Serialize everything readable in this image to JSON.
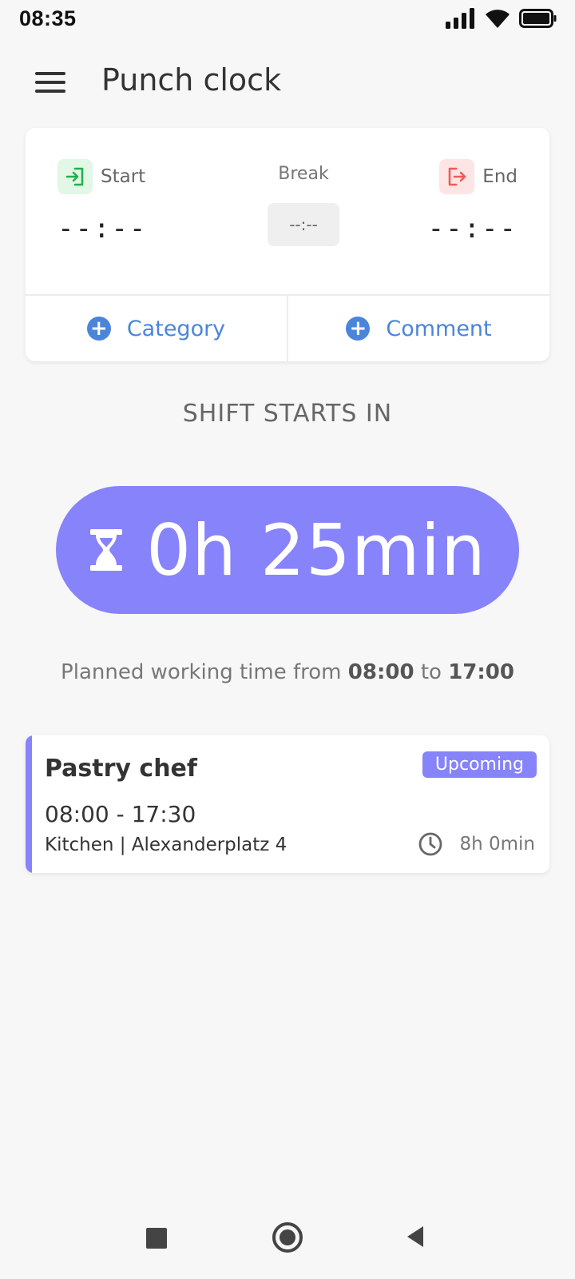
{
  "status_bar": {
    "time": "08:35",
    "icons": [
      "signal-icon",
      "wifi-icon",
      "battery-icon"
    ]
  },
  "app_bar": {
    "title": "Punch clock",
    "menu_icon": "hamburger-menu-icon"
  },
  "punch_card": {
    "start_label": "Start",
    "start_value": "--:--",
    "break_label": "Break",
    "break_value": "--:--",
    "end_label": "End",
    "end_value": "--:--",
    "category_label": "Category",
    "comment_label": "Comment",
    "colors": {
      "start": "#22b14c",
      "end": "#f05a5a",
      "action": "#4a85dc"
    }
  },
  "countdown": {
    "label": "SHIFT STARTS IN",
    "value": "0h 25min",
    "color": "#8683fb"
  },
  "planned": {
    "prefix": "Planned working time from",
    "from": "08:00",
    "connector": "to",
    "to": "17:00"
  },
  "shift": {
    "title": "Pastry chef",
    "badge": "Upcoming",
    "time": "08:00 - 17:30",
    "location": "Kitchen | Alexanderplatz 4",
    "duration": "8h 0min"
  }
}
